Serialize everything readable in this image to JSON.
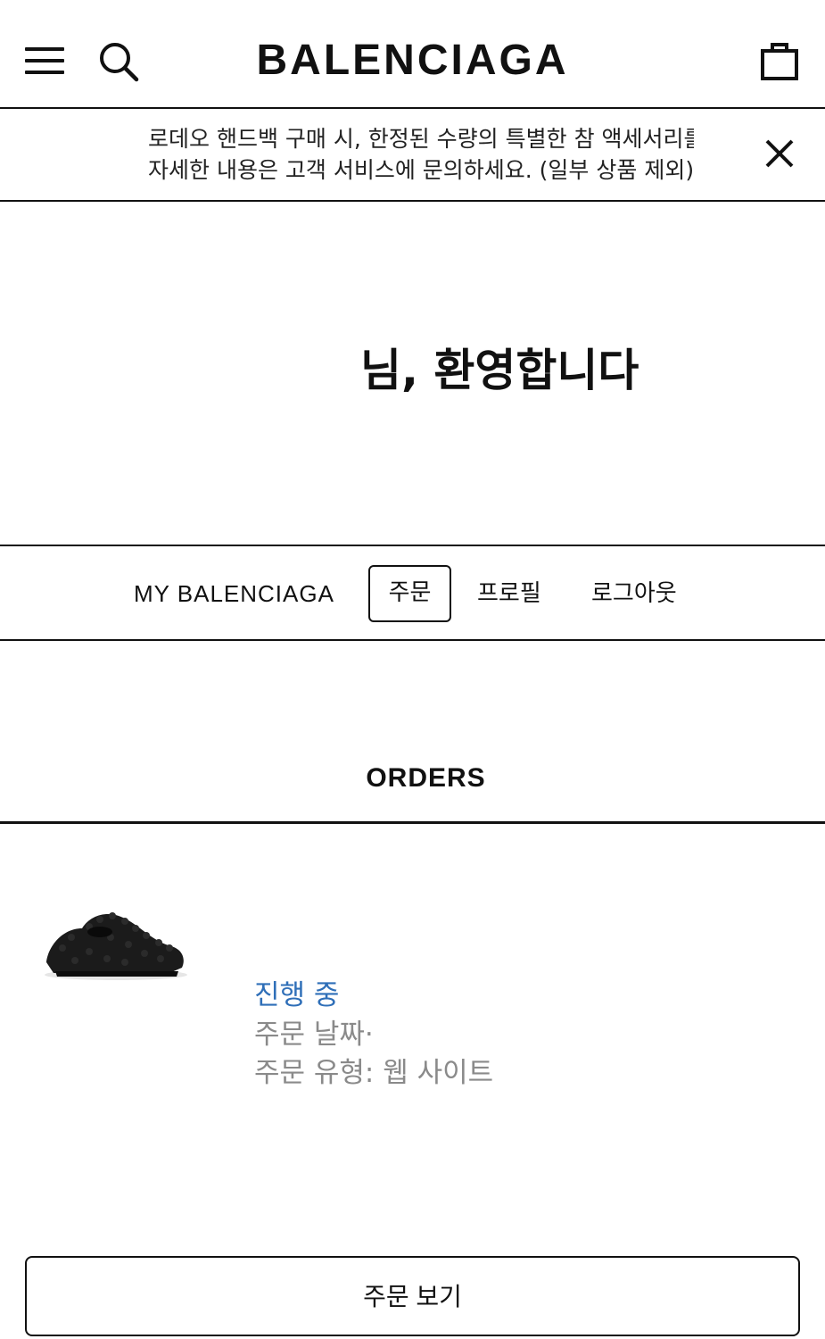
{
  "header": {
    "brand": "BALENCIAGA",
    "menu_icon": "hamburger-menu-icon",
    "search_icon": "search-icon",
    "cart_icon": "shopping-bag-icon"
  },
  "banner": {
    "line1": "로데오 핸드백 구매 시, 한정된 수량의 특별한 참 액세서리를",
    "line2": "자세한 내용은 고객 서비스에 문의하세요. (일부 상품 제외)",
    "close_icon": "close-icon"
  },
  "welcome": {
    "text": "님, 환영합니다"
  },
  "account_nav": {
    "label": "MY BALENCIAGA",
    "tabs": [
      {
        "label": "주문",
        "active": true
      },
      {
        "label": "프로필",
        "active": false
      },
      {
        "label": "로그아웃",
        "active": false
      }
    ]
  },
  "orders": {
    "title": "ORDERS",
    "items": [
      {
        "image": "black-rubber-clog-shoe",
        "status": "진행 중",
        "date_label": "주문 날짜·",
        "type_label": "주문 유형: 웹 사이트"
      }
    ],
    "view_button": "주문 보기"
  },
  "colors": {
    "status_blue": "#2f6fb8",
    "muted_gray": "#8a8a8a",
    "ink": "#111111"
  }
}
